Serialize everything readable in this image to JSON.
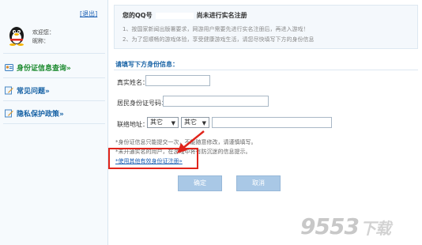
{
  "sidebar": {
    "logout": "[退出]",
    "welcome": "欢迎您：",
    "nickname_label": "昵称：",
    "items": [
      {
        "label": "身份证信息查询»",
        "icon": "id-card-icon"
      },
      {
        "label": "常见问题»",
        "icon": "pencil-icon"
      },
      {
        "label": "隐私保护政策»",
        "icon": "pencil-icon"
      }
    ]
  },
  "notice": {
    "title_prefix": "您的QQ号",
    "title_suffix": "尚未进行实名注册",
    "line1": "1、按国家新闻出版署要求，网游用户需要先进行实名注册后，再进入游戏！",
    "line2": "2、为了您顺畅的游戏体验，享受健康游戏生活，请您尽快填写下方的身份信息"
  },
  "form": {
    "title": "请填写下方身份信息：",
    "name_label": "真实姓名：",
    "id_label": "居民身份证号码：",
    "addr_label": "联络地址：",
    "select1": "其它",
    "select2": "其它"
  },
  "tips": {
    "tip1": "*身份证信息只能提交一次，不能随意修改，请谨慎填写。",
    "tip2": "*未开通实名的用户，在游戏中将有防沉迷的信息提示。",
    "other_reg": "*使用其他有效身份证注册»"
  },
  "buttons": {
    "ok": "确定",
    "cancel": "取消"
  },
  "watermark": {
    "brand": "9553",
    "suffix": "下载"
  },
  "colors": {
    "link": "#1a5fb4",
    "active": "#1b8a2e",
    "highlight": "#e0241b",
    "button": "#a9c8e6"
  }
}
